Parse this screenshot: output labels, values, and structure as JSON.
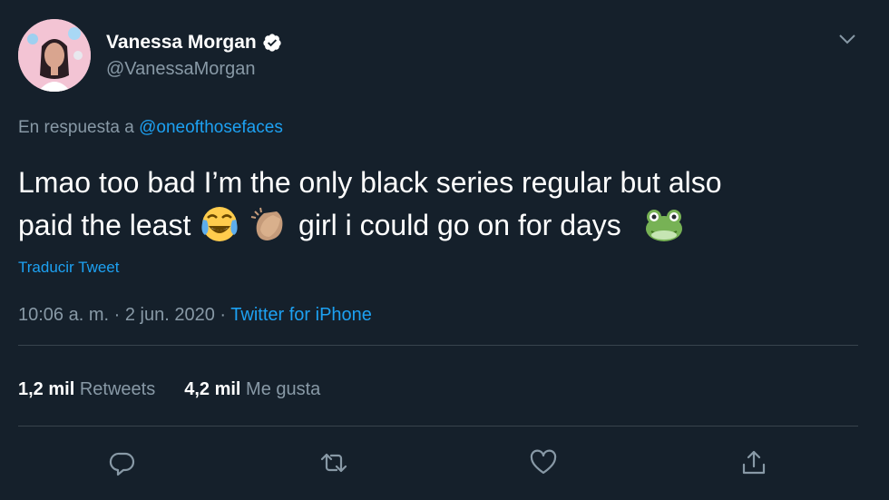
{
  "author": {
    "name": "Vanessa Morgan",
    "handle": "@VanessaMorgan"
  },
  "reply": {
    "prefix": "En respuesta a",
    "mention": "@oneofthosefaces"
  },
  "tweet": {
    "line1": "Lmao too bad I’m the only black series regular but also",
    "line2_part1": "paid the least",
    "line2_part2": "girl i could go on for days"
  },
  "translate_label": "Traducir Tweet",
  "meta": {
    "time": "10:06 a. m.",
    "sep1": "·",
    "date": "2 jun. 2020",
    "sep2": "·",
    "source": "Twitter for iPhone"
  },
  "stats": {
    "retweets_count": "1,2 mil",
    "retweets_label": "Retweets",
    "likes_count": "4,2 mil",
    "likes_label": "Me gusta"
  },
  "colors": {
    "background": "#15202b",
    "accent": "#1da1f2",
    "muted": "#8899a6",
    "divider": "#38444d"
  },
  "icons": [
    "verified-badge-icon",
    "chevron-down-icon",
    "reply-icon",
    "retweet-icon",
    "like-icon",
    "share-icon"
  ]
}
